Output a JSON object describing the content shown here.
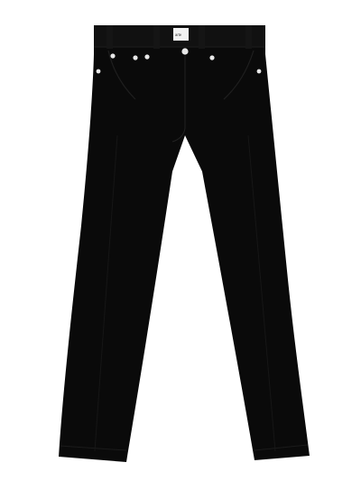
{
  "product": {
    "item": "jeans",
    "color": "black",
    "hardware_color": "#e8e8e8",
    "fabric_color": "#0a0a0a",
    "background_color": "#ffffff",
    "brand_label_text": "arte"
  }
}
